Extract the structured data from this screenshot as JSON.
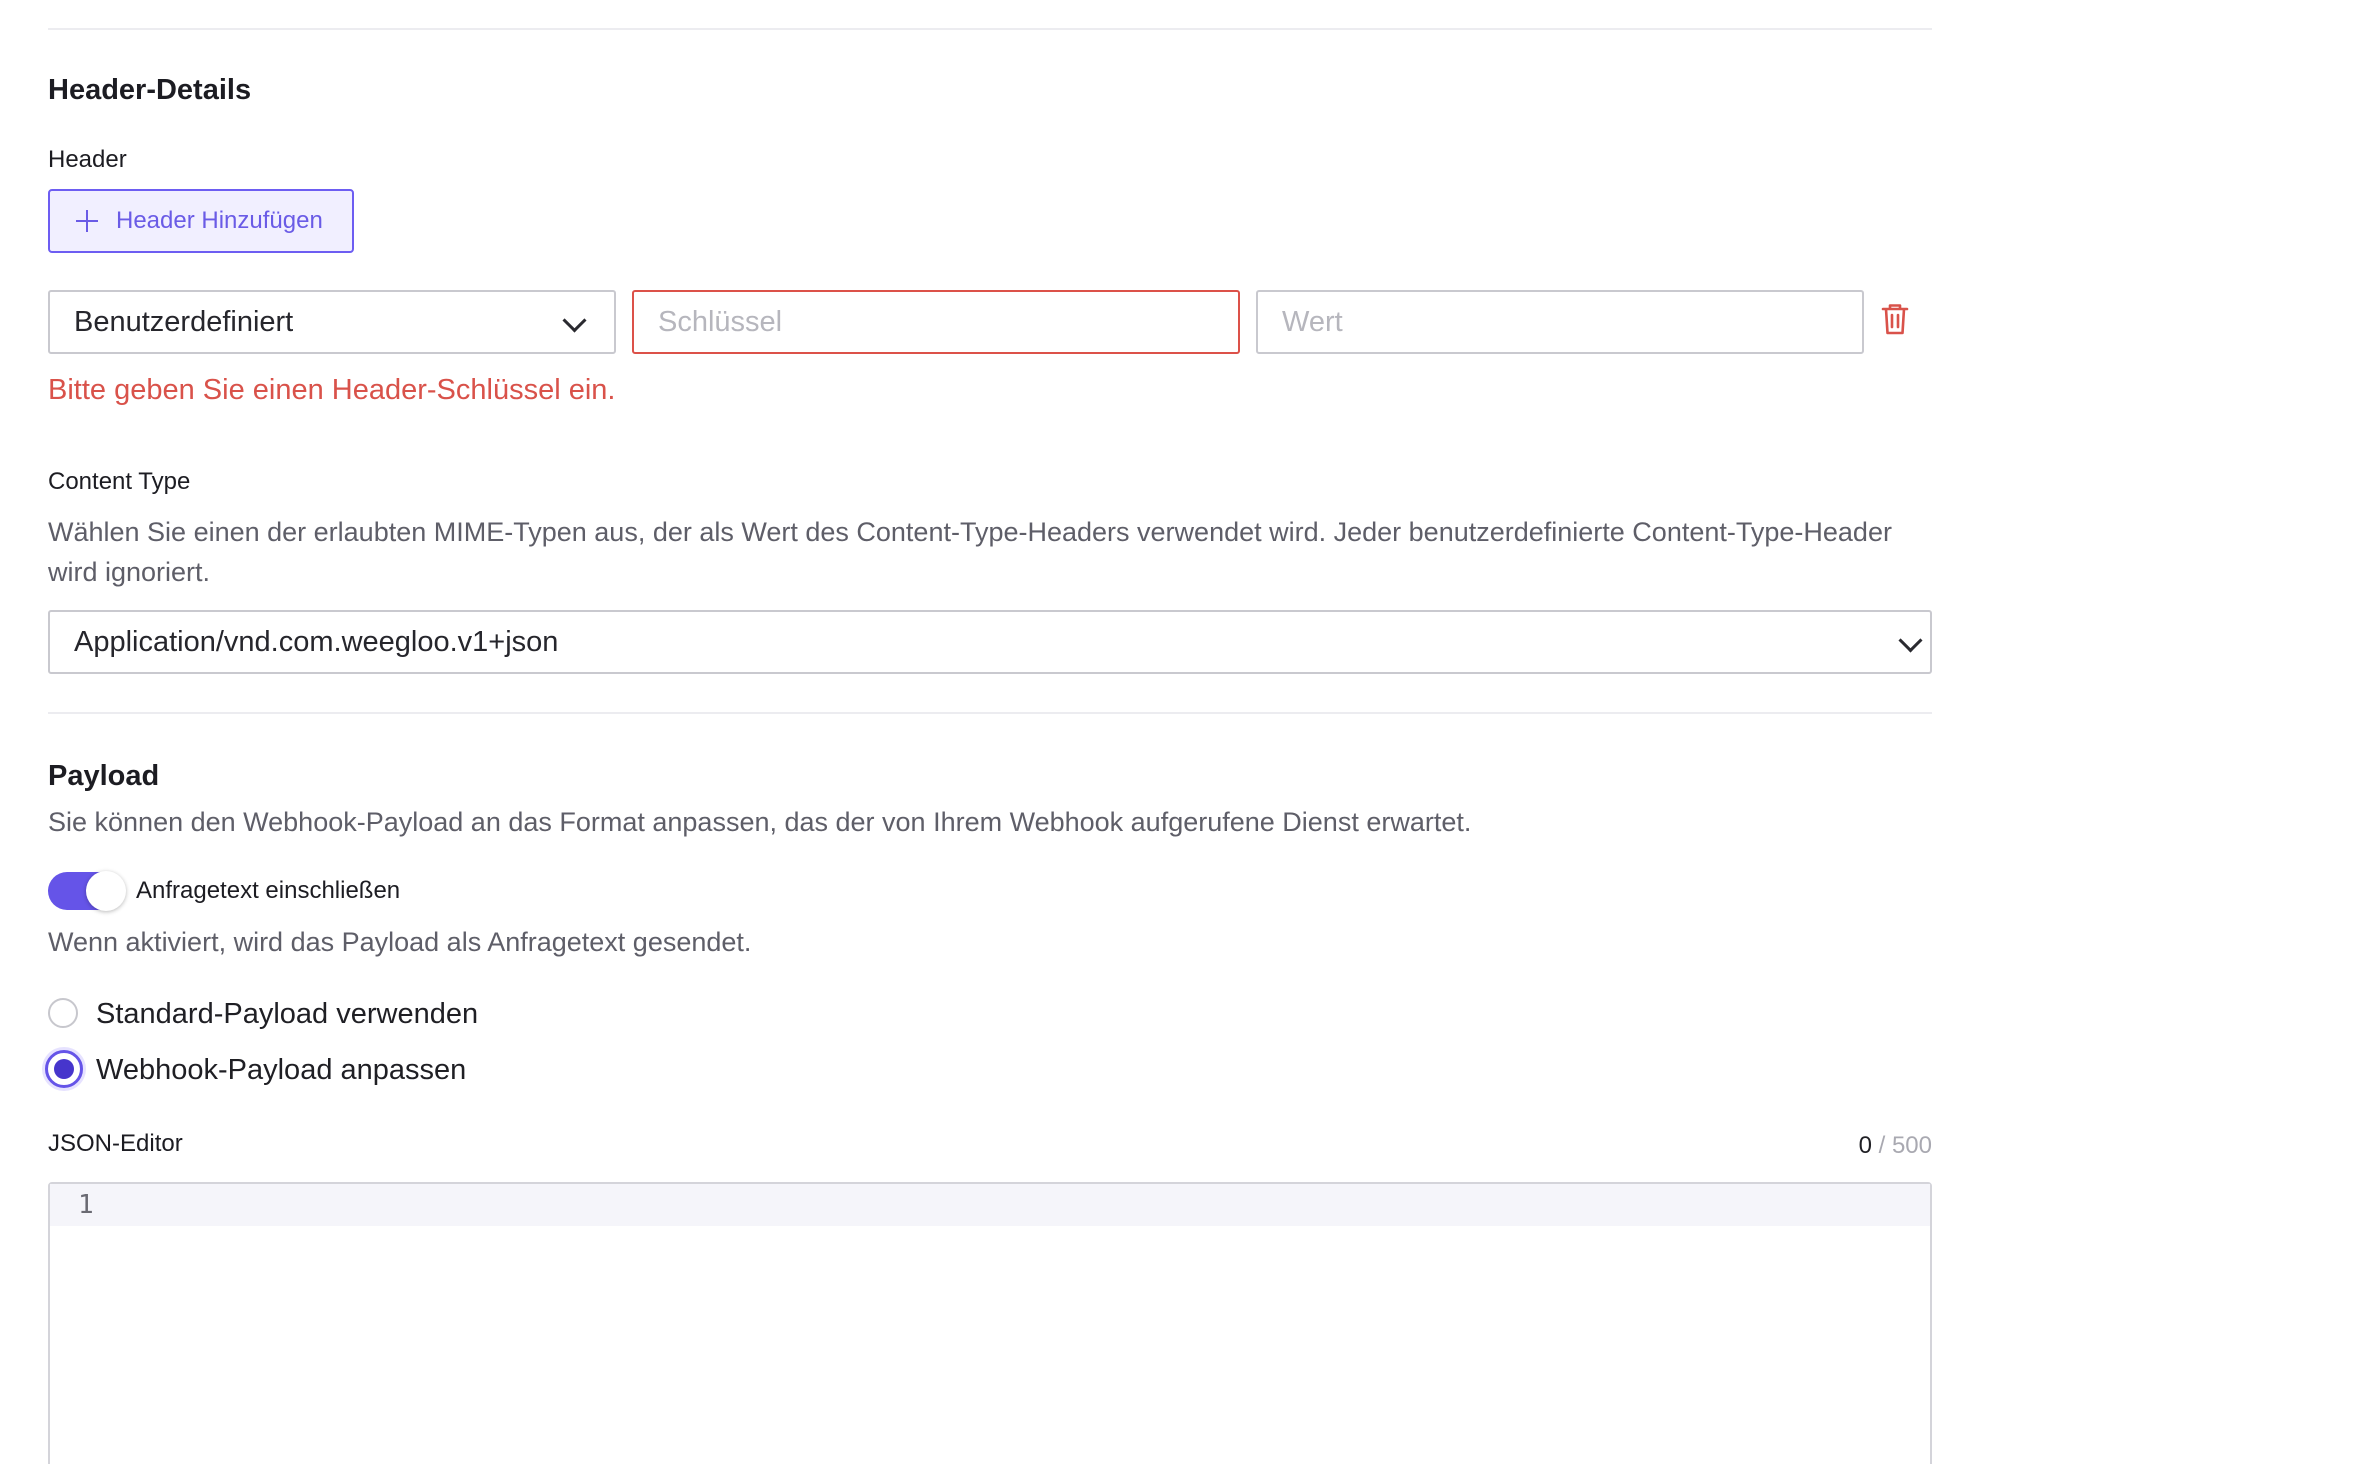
{
  "header_details": {
    "title": "Header-Details",
    "header_label": "Header",
    "add_button_label": "Header Hinzufügen",
    "row": {
      "type_value": "Benutzerdefiniert",
      "key_placeholder": "Schlüssel",
      "key_value": "",
      "value_placeholder": "Wert",
      "value_value": ""
    },
    "error_message": "Bitte geben Sie einen Header-Schlüssel ein."
  },
  "content_type": {
    "label": "Content Type",
    "description": "Wählen Sie einen der erlaubten MIME-Typen aus, der als Wert des Content-Type-Headers verwendet wird. Jeder benutzerdefinierte Content-Type-Header wird ignoriert.",
    "selected": "Application/vnd.com.weegloo.v1+json"
  },
  "payload": {
    "title": "Payload",
    "description": "Sie können den Webhook-Payload an das Format anpassen, das der von Ihrem Webhook aufgerufene Dienst erwartet.",
    "toggle_label": "Anfragetext einschließen",
    "toggle_on": true,
    "toggle_hint": "Wenn aktiviert, wird das Payload als Anfragetext gesendet.",
    "options": [
      {
        "label": "Standard-Payload verwenden",
        "selected": false
      },
      {
        "label": "Webhook-Payload anpassen",
        "selected": true
      }
    ],
    "editor_label": "JSON-Editor",
    "char_count": "0",
    "char_max": "/ 500",
    "line_number": "1"
  },
  "colors": {
    "accent": "#6554e8",
    "error": "#d9524a"
  }
}
